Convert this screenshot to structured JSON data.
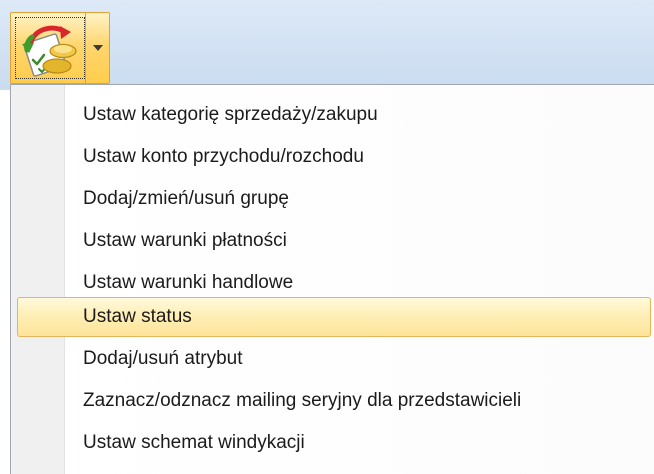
{
  "toolbar": {
    "button": {
      "icon": "change-status-icon",
      "dropdown_icon": "dropdown-arrow-icon",
      "state": "pressed"
    }
  },
  "menu": {
    "highlighted_index": 5,
    "items": [
      {
        "label": "Ustaw kategorię sprzedaży/zakupu"
      },
      {
        "label": "Ustaw konto przychodu/rozchodu"
      },
      {
        "label": "Dodaj/zmień/usuń grupę"
      },
      {
        "label": "Ustaw warunki płatności"
      },
      {
        "label": "Ustaw warunki handlowe"
      },
      {
        "label": "Ustaw status"
      },
      {
        "label": "Dodaj/usuń atrybut"
      },
      {
        "label": "Zaznacz/odznacz mailing seryjny dla przedstawicieli"
      },
      {
        "label": "Ustaw schemat windykacji"
      }
    ]
  },
  "colors": {
    "toolbar_background": "#d4e3f4",
    "button_pressed_fill": "#ffd56b",
    "button_border": "#e1a13a",
    "highlight_fill": "#ffefb7",
    "highlight_border": "#e5b55c",
    "menu_text": "#1b1b1b"
  }
}
